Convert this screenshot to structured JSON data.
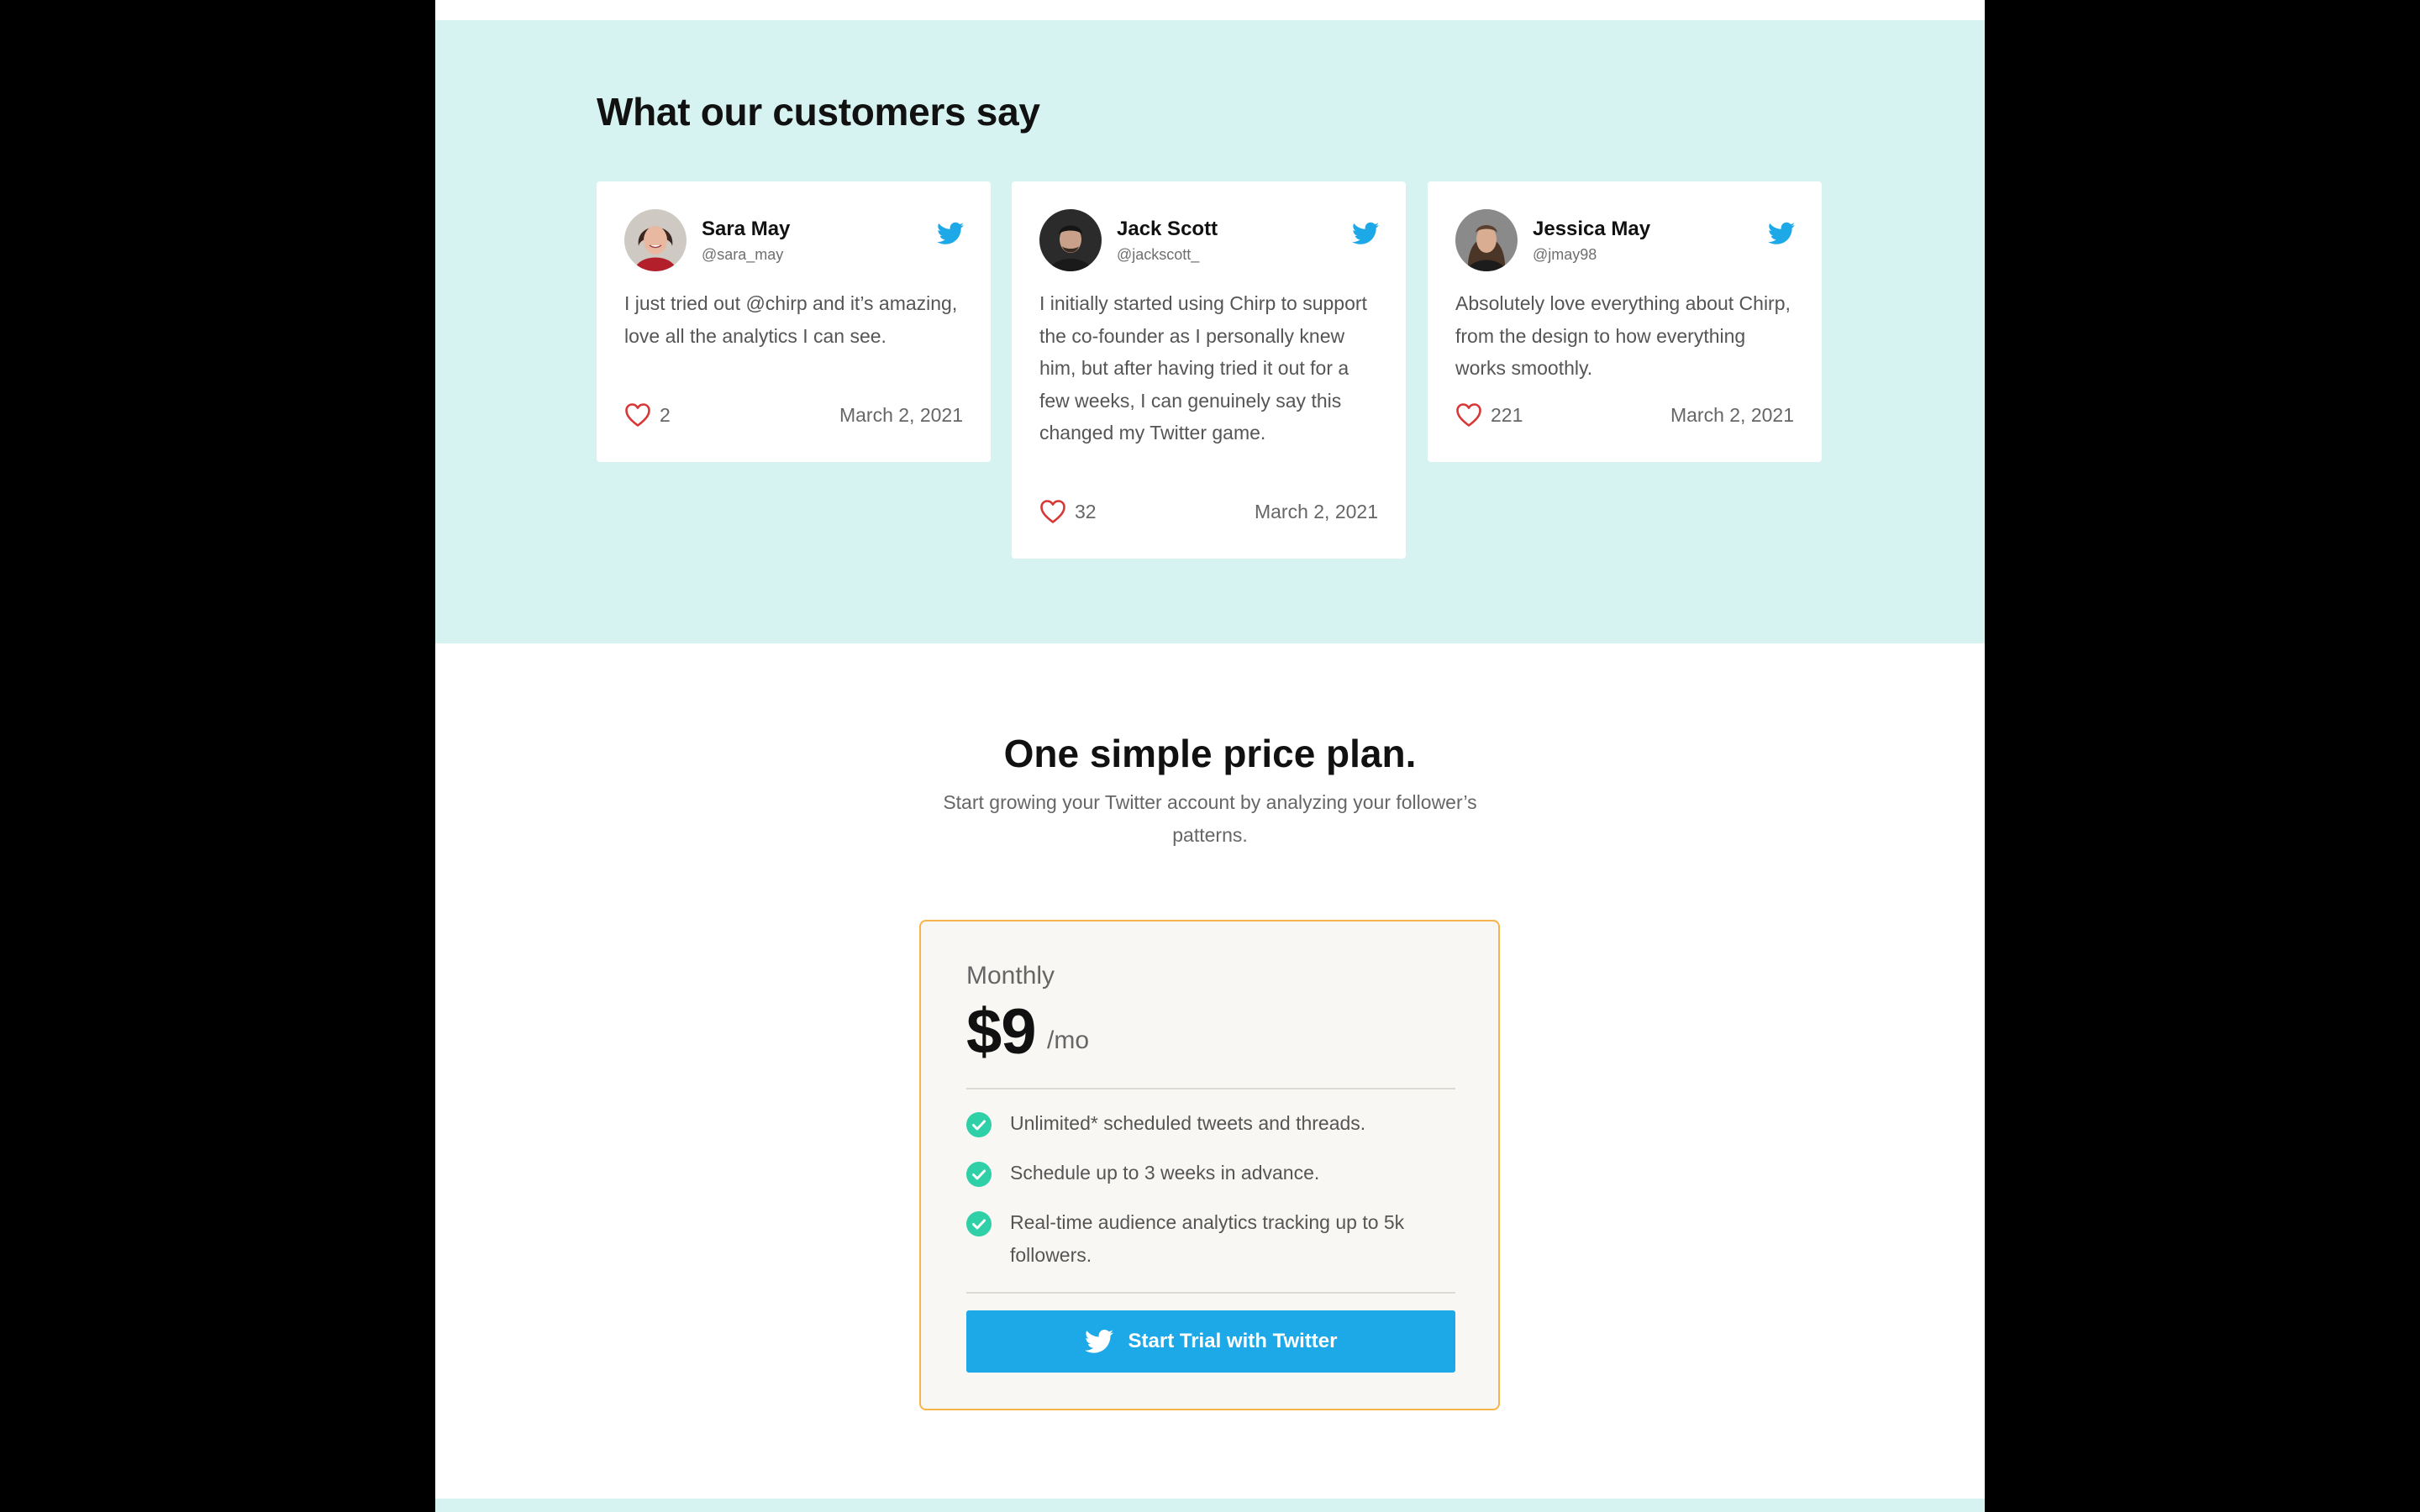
{
  "testimonials": {
    "title": "What our customers say",
    "cards": [
      {
        "name": "Sara May",
        "handle": "@sara_may",
        "text": "I just tried out @chirp and it’s amazing, love all the analytics I can see.",
        "likes": "2",
        "date": "March 2, 2021"
      },
      {
        "name": "Jack Scott",
        "handle": "@jackscott_",
        "text": "I initially started using Chirp to support the co-founder as I personally knew him, but after having tried it out for a few weeks, I can genuinely say this changed my Twitter game.",
        "likes": "32",
        "date": "March 2, 2021"
      },
      {
        "name": "Jessica May",
        "handle": "@jmay98",
        "text": "Absolutely love everything about Chirp, from the design to how everything works smoothly.",
        "likes": "221",
        "date": "March 2, 2021"
      }
    ]
  },
  "pricing": {
    "title": "One simple price plan.",
    "subtitle": "Start growing your Twitter account by analyzing your follower’s patterns.",
    "plan": {
      "period": "Monthly",
      "price": "$9",
      "per": "/mo",
      "features": [
        "Unlimited* scheduled tweets and threads.",
        "Schedule up to 3 weeks in advance.",
        "Real-time audience analytics tracking up to 5k followers."
      ],
      "cta_label": "Start Trial with Twitter"
    }
  },
  "colors": {
    "band": "#d6f3f2",
    "twitter_blue": "#1da8e8",
    "heart_red": "#d93636",
    "check_green": "#2fd0a7",
    "plan_border": "#f6b54a"
  },
  "icons": {
    "bird": "twitter-bird-icon",
    "heart": "heart-outline-icon",
    "check": "check-circle-icon"
  }
}
